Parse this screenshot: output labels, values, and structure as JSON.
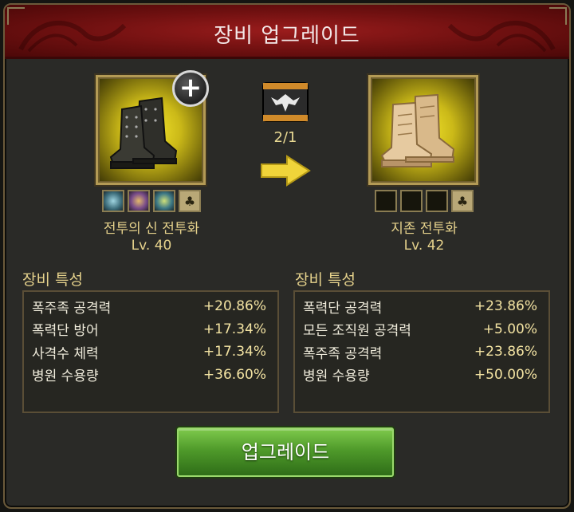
{
  "header": {
    "title": "장비 업그레이드"
  },
  "current_item": {
    "icon": "dark-combat-boots-icon",
    "name": "전투의 신 전투화",
    "level": "Lv. 40",
    "sockets": [
      "cyan-gem",
      "mixed-gem",
      "green-gem",
      "club-slot"
    ]
  },
  "upgraded_item": {
    "icon": "desert-tan-boots-icon",
    "name": "지존 전투화",
    "level": "Lv. 42",
    "sockets": [
      "empty",
      "empty",
      "empty",
      "club-slot"
    ]
  },
  "material": {
    "icon": "eagle-emblem-scroll-icon",
    "count": "2/1"
  },
  "stats_left": {
    "label": "장비 특성",
    "rows": [
      {
        "name": "폭주족 공격력",
        "value": "+20.86%"
      },
      {
        "name": "폭력단 방어",
        "value": "+17.34%"
      },
      {
        "name": "사격수 체력",
        "value": "+17.34%"
      },
      {
        "name": "병원 수용량",
        "value": "+36.60%"
      }
    ]
  },
  "stats_right": {
    "label": "장비 특성",
    "rows": [
      {
        "name": "폭력단 공격력",
        "value": "+23.86%"
      },
      {
        "name": "모든 조직원 공격력",
        "value": "+5.00%"
      },
      {
        "name": "폭주족 공격력",
        "value": "+23.86%"
      },
      {
        "name": "병원 수용량",
        "value": "+50.00%"
      }
    ]
  },
  "upgrade_button": {
    "label": "업그레이드"
  },
  "colors": {
    "title_bar": "#7a1212",
    "accent_text": "#e6d28c",
    "button_green": "#4f9a2a"
  }
}
